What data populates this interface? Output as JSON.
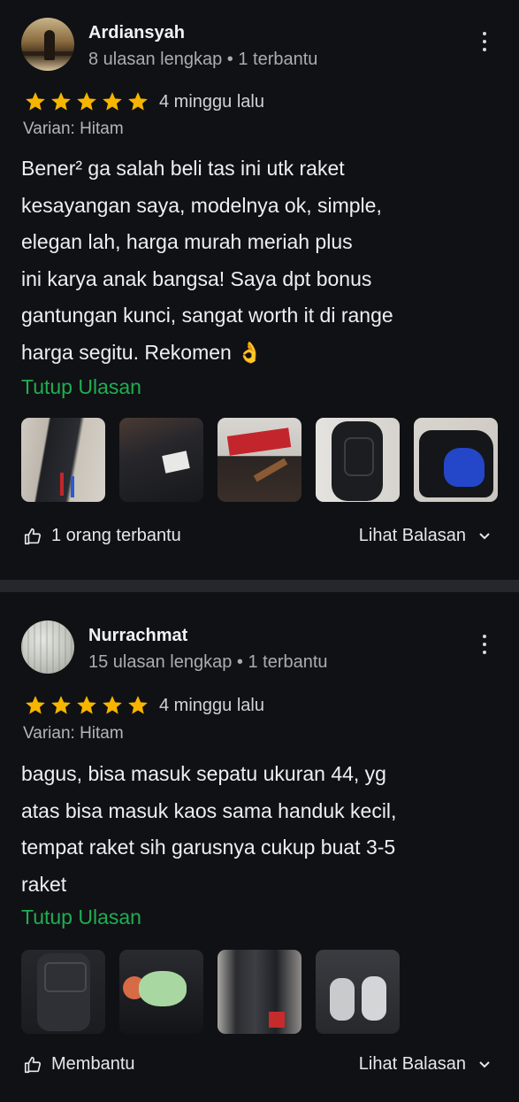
{
  "reviews": [
    {
      "name": "Ardiansyah",
      "meta": "8 ulasan lengkap • 1 terbantu",
      "stars": 5,
      "time": "4 minggu lalu",
      "variant": "Varian: Hitam",
      "text": "Bener² ga salah beli tas ini utk raket\nkesayangan saya, modelnya ok, simple,\nelegan lah, harga murah meriah plus\nini karya anak bangsa! Saya dpt bonus\ngantungan kunci, sangat worth it di range\nharga segitu. Rekomen 👌",
      "collapse_label": "Tutup Ulasan",
      "helpful_label": "1 orang terbantu",
      "replies_label": "Lihat Balasan"
    },
    {
      "name": "Nurrachmat",
      "meta": "15 ulasan lengkap • 1 terbantu",
      "stars": 5,
      "time": "4 minggu lalu",
      "variant": "Varian: Hitam",
      "text": "bagus, bisa masuk sepatu ukuran 44, yg\natas bisa masuk kaos sama handuk kecil,\ntempat raket sih garusnya cukup buat 3-5\nraket",
      "collapse_label": "Tutup Ulasan",
      "helpful_label": "Membantu",
      "replies_label": "Lihat Balasan"
    }
  ],
  "colors": {
    "background": "#101114",
    "separator": "#25272c",
    "star": "#f7b500",
    "link_green": "#1fae52",
    "muted_text": "#a9acb2"
  },
  "icons": [
    "kebab-menu-icon",
    "star-icon",
    "thumbs-up-icon",
    "chevron-down-icon"
  ]
}
